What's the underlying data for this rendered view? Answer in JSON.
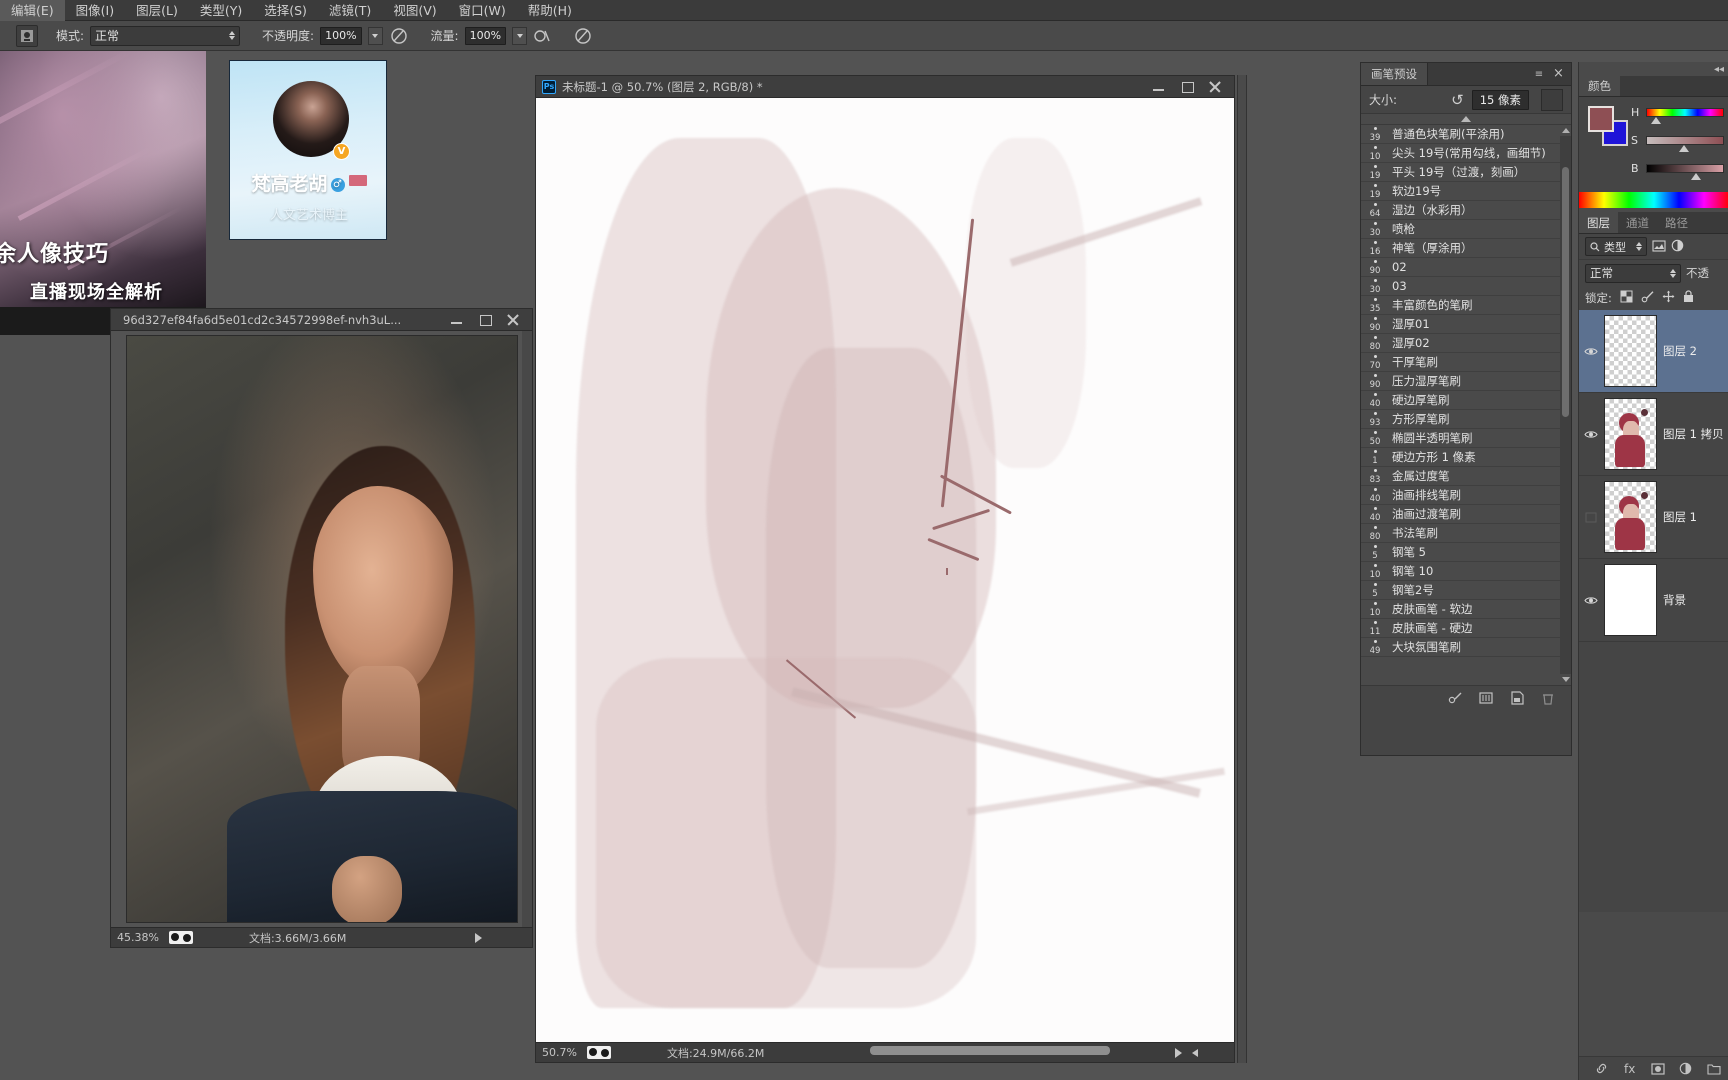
{
  "menubar": {
    "items": [
      {
        "label": "编辑(E)",
        "name": "menu-edit"
      },
      {
        "label": "图像(I)",
        "name": "menu-image"
      },
      {
        "label": "图层(L)",
        "name": "menu-layer"
      },
      {
        "label": "类型(Y)",
        "name": "menu-type"
      },
      {
        "label": "选择(S)",
        "name": "menu-select"
      },
      {
        "label": "滤镜(T)",
        "name": "menu-filter"
      },
      {
        "label": "视图(V)",
        "name": "menu-view"
      },
      {
        "label": "窗口(W)",
        "name": "menu-window"
      },
      {
        "label": "帮助(H)",
        "name": "menu-help"
      }
    ]
  },
  "options_bar": {
    "mode_label": "模式:",
    "mode_value": "正常",
    "opacity_label": "不透明度:",
    "opacity_value": "100%",
    "flow_label": "流量:",
    "flow_value": "100%"
  },
  "video_overlay": {
    "line1": "余人像技巧",
    "line2": "直播现场全解析"
  },
  "profile_card": {
    "name": "梵高老胡",
    "verified_badge": "V",
    "gender_icon": "male-icon",
    "description": "人文艺术博主"
  },
  "window_photo": {
    "title": "96d327ef84fa6d5e01cd2c34572998ef-nvh3uL...",
    "zoom": "45.38%",
    "doc_label": "文档:3.66M/3.66M"
  },
  "window_main": {
    "title": "未标题-1 @ 50.7% (图层 2, RGB/8) *",
    "zoom": "50.7%",
    "doc_label": "文档:24.9M/66.2M"
  },
  "brush_panel": {
    "tab_label": "画笔预设",
    "size_label": "大小:",
    "size_value": "15 像素",
    "reset_icon": "reset-arrow-icon",
    "close_icon": "close-icon",
    "presets": [
      {
        "num": "39",
        "name": "普通色块笔刷(平涂用)"
      },
      {
        "num": "10",
        "name": "尖头 19号(常用勾线，画细节)"
      },
      {
        "num": "19",
        "name": "平头 19号（过渡，刻画）"
      },
      {
        "num": "19",
        "name": "软边19号"
      },
      {
        "num": "64",
        "name": "湿边（水彩用）"
      },
      {
        "num": "30",
        "name": "喷枪"
      },
      {
        "num": "16",
        "name": "神笔（厚涂用）"
      },
      {
        "num": "90",
        "name": "02"
      },
      {
        "num": "30",
        "name": "03"
      },
      {
        "num": "35",
        "name": "丰富颜色的笔刷"
      },
      {
        "num": "90",
        "name": "湿厚01"
      },
      {
        "num": "80",
        "name": "湿厚02"
      },
      {
        "num": "70",
        "name": "干厚笔刷"
      },
      {
        "num": "90",
        "name": "压力湿厚笔刷"
      },
      {
        "num": "40",
        "name": "硬边厚笔刷"
      },
      {
        "num": "93",
        "name": "方形厚笔刷"
      },
      {
        "num": "50",
        "name": "椭圆半透明笔刷"
      },
      {
        "num": "1",
        "name": "硬边方形 1 像素"
      },
      {
        "num": "83",
        "name": "金属过度笔"
      },
      {
        "num": "40",
        "name": "油画排线笔刷"
      },
      {
        "num": "40",
        "name": "油画过渡笔刷"
      },
      {
        "num": "80",
        "name": "书法笔刷"
      },
      {
        "num": "5",
        "name": "钢笔 5"
      },
      {
        "num": "10",
        "name": "钢笔 10"
      },
      {
        "num": "5",
        "name": "钢笔2号"
      },
      {
        "num": "10",
        "name": "皮肤画笔 - 软边"
      },
      {
        "num": "11",
        "name": "皮肤画笔 - 硬边"
      },
      {
        "num": "49",
        "name": "大块氛围笔刷"
      }
    ],
    "footer_icons": [
      "new-brush-icon",
      "preset-manager-icon",
      "new-preset-icon",
      "delete-icon"
    ]
  },
  "color_panel": {
    "tab_label": "颜色",
    "foreground_hex": "#8e4f54",
    "background_hex": "#1f14d8",
    "sliders": [
      {
        "label": "H",
        "value": 8
      },
      {
        "label": "S",
        "value": 45
      },
      {
        "label": "B",
        "value": 56
      }
    ]
  },
  "layers_panel": {
    "tabs": [
      {
        "label": "图层",
        "active": true
      },
      {
        "label": "通道",
        "active": false
      },
      {
        "label": "路径",
        "active": false
      }
    ],
    "filter_label": "类型",
    "filter_icon": "search-icon",
    "blend_mode": "正常",
    "opacity_label": "不透",
    "lock_label": "锁定:",
    "lock_icons": [
      "lock-transparent-icon",
      "lock-paint-icon",
      "lock-move-icon",
      "lock-all-icon"
    ],
    "layers": [
      {
        "name": "图层 2",
        "visible": true,
        "selected": true,
        "kind": "empty"
      },
      {
        "name": "图层 1 拷贝",
        "visible": true,
        "selected": false,
        "kind": "figure"
      },
      {
        "name": "图层 1",
        "visible": false,
        "selected": false,
        "kind": "figure"
      },
      {
        "name": "背景",
        "visible": true,
        "selected": false,
        "kind": "white"
      }
    ]
  }
}
